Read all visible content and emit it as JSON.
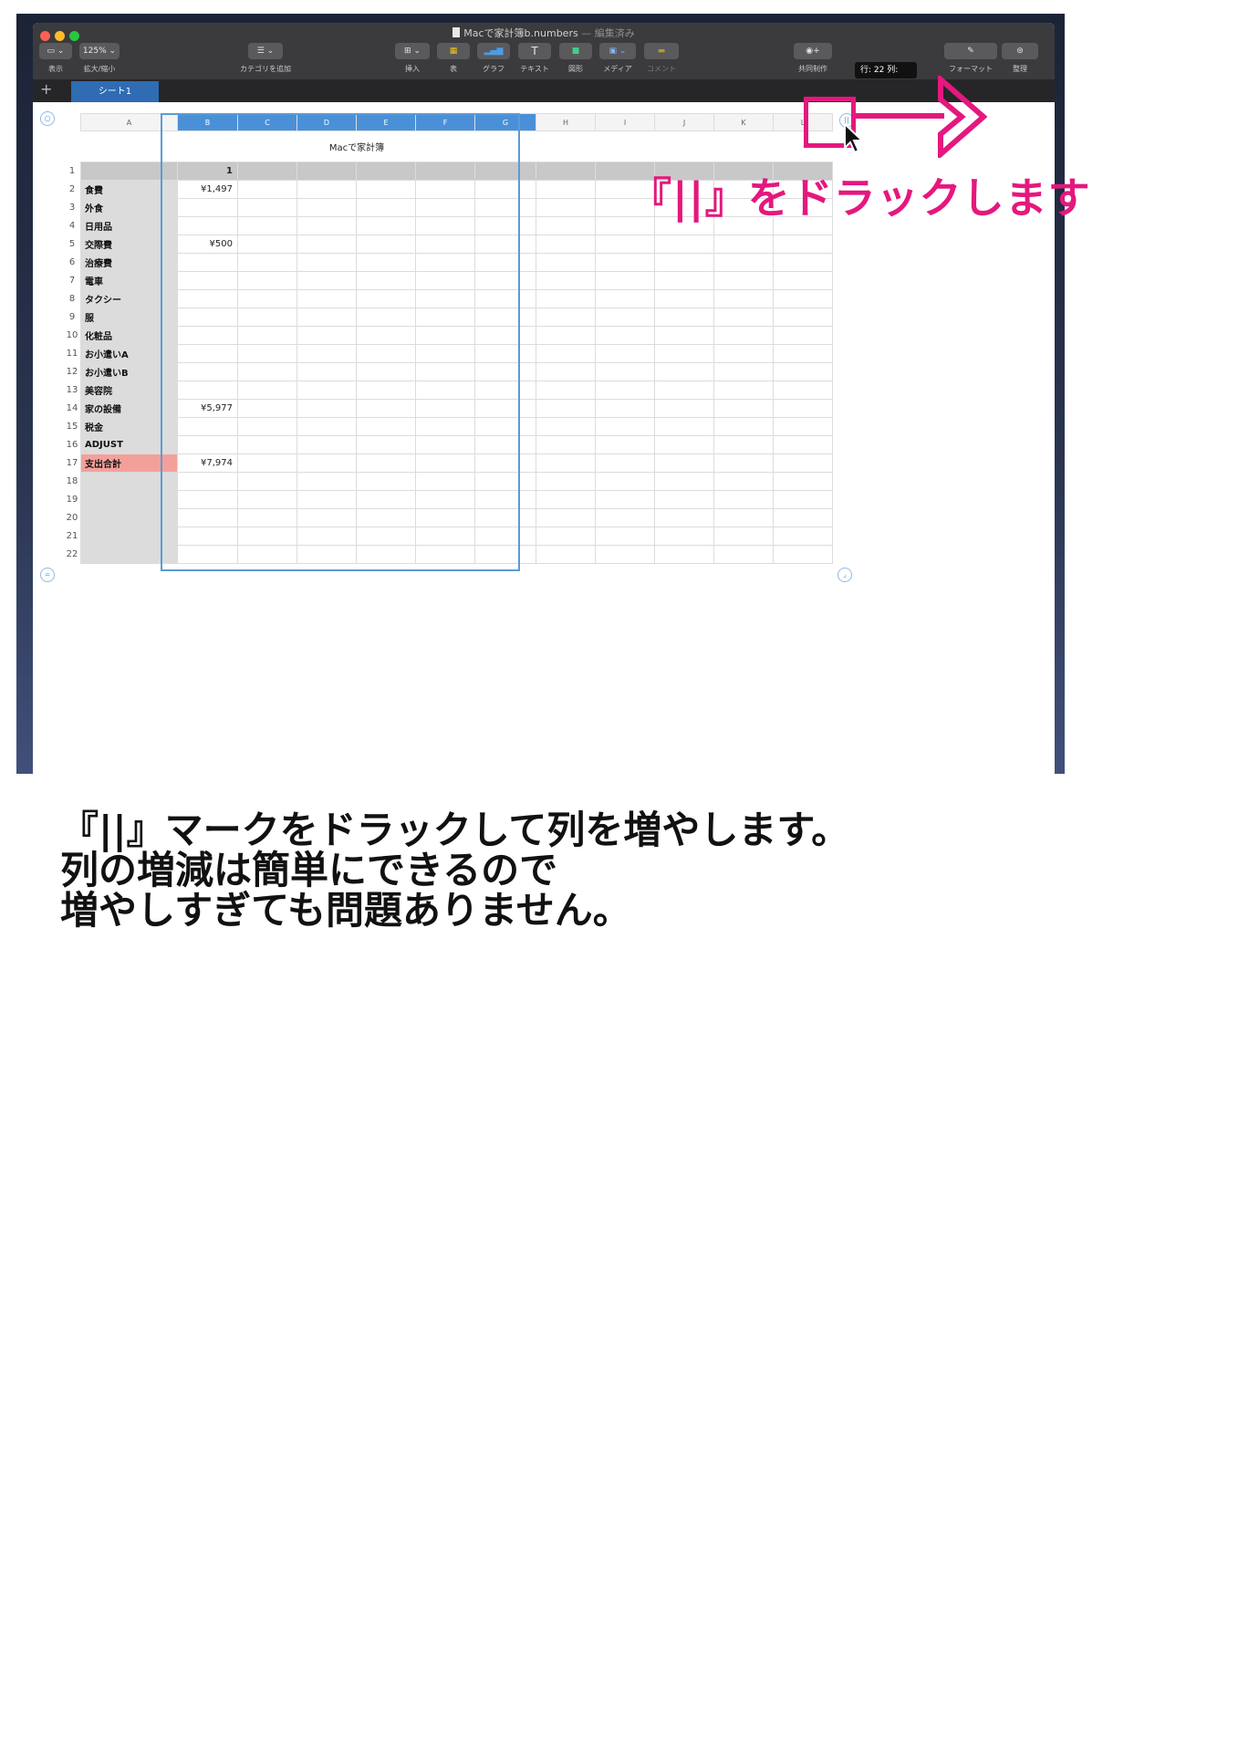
{
  "window": {
    "title": "Macで家計簿b.numbers",
    "title_suffix": "— 編集済み"
  },
  "toolbar": {
    "view": "表示",
    "zoom_value": "125%",
    "zoom": "拡大/縮小",
    "category": "カテゴリを追加",
    "insert": "挿入",
    "table": "表",
    "chart": "グラフ",
    "text": "テキスト",
    "shape": "図形",
    "media": "メディア",
    "comment": "コメント",
    "collaborate": "共同制作",
    "format": "フォーマット",
    "organize": "整理"
  },
  "tabs": {
    "sheet1": "シート1"
  },
  "tooltip": "行: 22  列:",
  "sheet": {
    "title": "Macで家計簿",
    "columns": [
      "A",
      "B",
      "C",
      "D",
      "E",
      "F",
      "G",
      "H",
      "I",
      "J",
      "K",
      "L"
    ],
    "header_value": "1",
    "rows": [
      {
        "n": "1",
        "label": "",
        "value": ""
      },
      {
        "n": "2",
        "label": "食費",
        "value": "¥1,497"
      },
      {
        "n": "3",
        "label": "外食",
        "value": ""
      },
      {
        "n": "4",
        "label": "日用品",
        "value": ""
      },
      {
        "n": "5",
        "label": "交際費",
        "value": "¥500"
      },
      {
        "n": "6",
        "label": "治療費",
        "value": ""
      },
      {
        "n": "7",
        "label": "電車",
        "value": ""
      },
      {
        "n": "8",
        "label": "タクシー",
        "value": ""
      },
      {
        "n": "9",
        "label": "服",
        "value": ""
      },
      {
        "n": "10",
        "label": "化粧品",
        "value": ""
      },
      {
        "n": "11",
        "label": "お小遣いA",
        "value": ""
      },
      {
        "n": "12",
        "label": "お小遣いB",
        "value": ""
      },
      {
        "n": "13",
        "label": "美容院",
        "value": ""
      },
      {
        "n": "14",
        "label": "家の設備",
        "value": "¥5,977"
      },
      {
        "n": "15",
        "label": "税金",
        "value": ""
      },
      {
        "n": "16",
        "label": "ADJUST",
        "value": ""
      },
      {
        "n": "17",
        "label": "支出合計",
        "value": "¥7,974"
      },
      {
        "n": "18",
        "label": "",
        "value": ""
      },
      {
        "n": "19",
        "label": "",
        "value": ""
      },
      {
        "n": "20",
        "label": "",
        "value": ""
      },
      {
        "n": "21",
        "label": "",
        "value": ""
      },
      {
        "n": "22",
        "label": "",
        "value": ""
      }
    ]
  },
  "annotation": {
    "callout": "『||』をドラックします",
    "handle_glyph": "||",
    "color": "#e4187e"
  },
  "caption": {
    "line1": "『||』マークをドラックして列を増やします。",
    "line2": "列の増減は簡単にできるので",
    "line3": "増やしすぎても問題ありません。"
  }
}
